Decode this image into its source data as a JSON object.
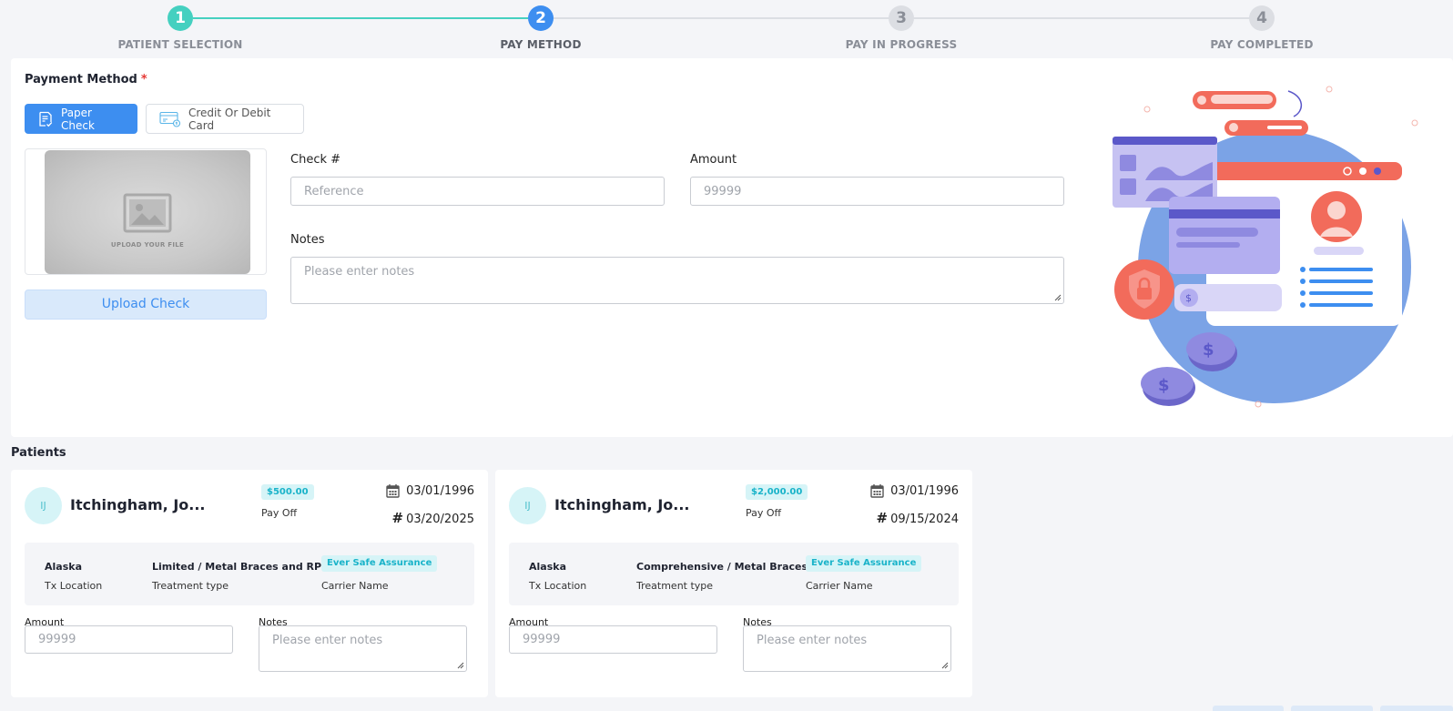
{
  "stepper": {
    "steps": [
      {
        "number": "1",
        "label": "PATIENT SELECTION",
        "state": "completed",
        "color": "#45d0c0"
      },
      {
        "number": "2",
        "label": "PAY METHOD",
        "state": "active",
        "color": "#3d8ef0"
      },
      {
        "number": "3",
        "label": "PAY IN PROGRESS",
        "state": "pending",
        "color": "#d9dbe0"
      },
      {
        "number": "4",
        "label": "PAY COMPLETED",
        "state": "pending",
        "color": "#d9dbe0"
      }
    ]
  },
  "payment": {
    "title": "Payment Method",
    "required_mark": "*",
    "methods": {
      "paper_check": "Paper Check",
      "card": "Credit Or Debit Card"
    },
    "upload_text": "UPLOAD YOUR FILE",
    "upload_button": "Upload Check",
    "check_label": "Check #",
    "check_placeholder": "Reference",
    "amount_label": "Amount",
    "amount_placeholder": "99999",
    "notes_label": "Notes",
    "notes_placeholder": "Please enter notes"
  },
  "patients": {
    "title": "Patients",
    "cards": [
      {
        "initials": "IJ",
        "name": "Itchingham, Jo...",
        "amount_badge": "$500.00",
        "pay_type": "Pay Off",
        "dob": "03/01/1996",
        "hash": "#",
        "date": "03/20/2025",
        "location": "Alaska",
        "location_label": "Tx Location",
        "treatment": "Limited / Metal Braces and RPE",
        "treatment_label": "Treatment type",
        "carrier": "Ever Safe Assurance",
        "carrier_label": "Carrier Name",
        "amount_label": "Amount",
        "amount_placeholder": "99999",
        "notes_label": "Notes",
        "notes_placeholder": "Please enter notes"
      },
      {
        "initials": "IJ",
        "name": "Itchingham, Jo...",
        "amount_badge": "$2,000.00",
        "pay_type": "Pay Off",
        "dob": "03/01/1996",
        "hash": "#",
        "date": "09/15/2024",
        "location": "Alaska",
        "location_label": "Tx Location",
        "treatment": "Comprehensive / Metal Braces",
        "treatment_label": "Treatment type",
        "carrier": "Ever Safe Assurance",
        "carrier_label": "Carrier Name",
        "amount_label": "Amount",
        "amount_placeholder": "99999",
        "notes_label": "Notes",
        "notes_placeholder": "Please enter notes"
      }
    ]
  },
  "colors": {
    "primary": "#3d8ef0",
    "teal": "#45d0c0",
    "badge_bg": "#d6f4f7",
    "badge_text": "#19b3c9",
    "required": "#e53935"
  }
}
